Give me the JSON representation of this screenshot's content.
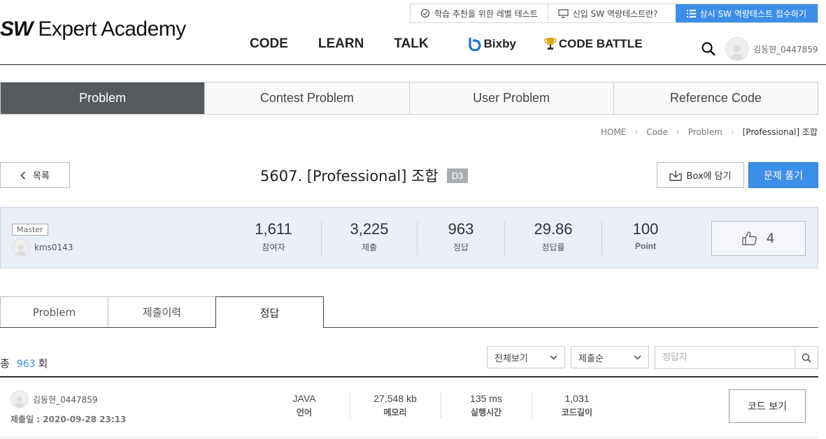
{
  "header": {
    "logo_bold": "SW",
    "logo_text": "Expert Academy",
    "util_links": [
      {
        "label": "학습 추천을 위한 레벨 테스트",
        "icon": "check-circle-icon"
      },
      {
        "label": "신입 SW 역량테스트란?",
        "icon": "monitor-icon"
      },
      {
        "label": "상시 SW 역량테스트 접수하기",
        "icon": "list-icon"
      }
    ],
    "nav": {
      "code": "CODE",
      "learn": "LEARN",
      "talk": "TALK",
      "bixby": "Bixby",
      "code_battle": "CODE BATTLE"
    },
    "user_name": "김동현_0447859"
  },
  "category_tabs": [
    "Problem",
    "Contest Problem",
    "User Problem",
    "Reference Code"
  ],
  "breadcrumb": [
    "HOME",
    "Code",
    "Problem",
    "[Professional] 조합"
  ],
  "problem": {
    "list_label": "목록",
    "title": "5607. [Professional] 조합",
    "level": "D3",
    "box_label": "Box에 담기",
    "solve_label": "문제 풀기"
  },
  "stats": {
    "badge": "Master",
    "author": "kms0143",
    "items": [
      {
        "value": "1,611",
        "label": "참여자"
      },
      {
        "value": "3,225",
        "label": "제출"
      },
      {
        "value": "963",
        "label": "정답"
      },
      {
        "value": "29.86",
        "label": "정답률"
      },
      {
        "value": "100",
        "label": "Point"
      }
    ],
    "likes": "4"
  },
  "sub_tabs": [
    "Problem",
    "제출이력",
    "정답"
  ],
  "filter": {
    "total_prefix": "총",
    "total_count": "963",
    "total_suffix": "회",
    "view_select": "전체보기",
    "order_select": "제출순",
    "search_placeholder": "정답자"
  },
  "results": [
    {
      "user": "김동현_0447859",
      "date": "제출일 : 2020-09-28 23:13",
      "language": "JAVA",
      "language_label": "언어",
      "memory": "27,548 kb",
      "memory_label": "메모리",
      "time": "135 ms",
      "time_label": "실행시간",
      "length": "1,031",
      "length_label": "코드길이",
      "button": "코드 보기"
    }
  ],
  "colors": {
    "accent": "#3d8ee8",
    "active_tab": "#555a5f",
    "stats_bg": "#eaeff8",
    "level_badge": "#a9adb2"
  }
}
